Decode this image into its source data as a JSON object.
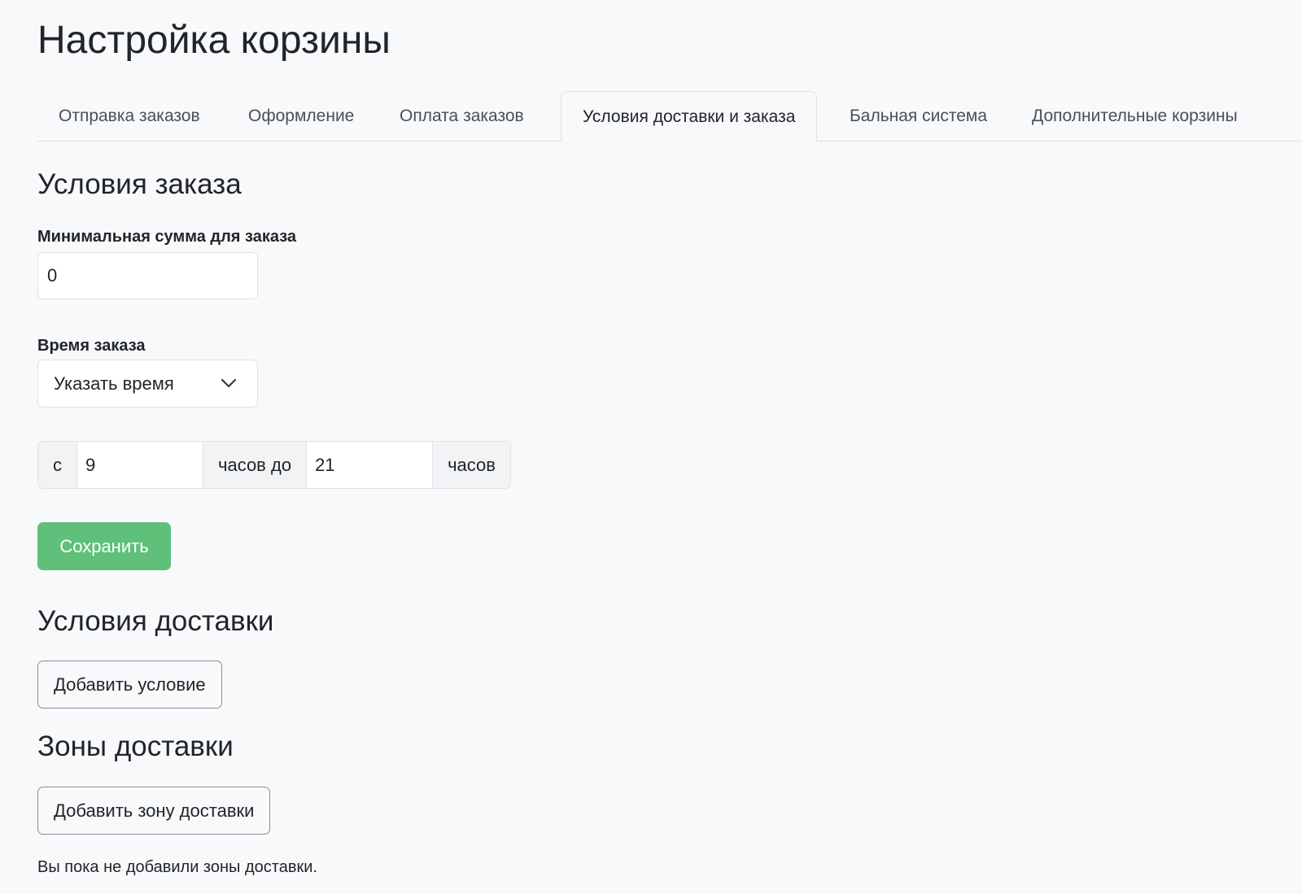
{
  "page": {
    "title": "Настройка корзины"
  },
  "tabs": [
    {
      "label": "Отправка заказов",
      "active": false
    },
    {
      "label": "Оформление",
      "active": false
    },
    {
      "label": "Оплата заказов",
      "active": false
    },
    {
      "label": "Условия доставки и заказа",
      "active": true
    },
    {
      "label": "Бальная система",
      "active": false
    },
    {
      "label": "Дополнительные корзины",
      "active": false
    }
  ],
  "order_conditions": {
    "title": "Условия заказа",
    "min_sum_label": "Минимальная сумма для заказа",
    "min_sum_value": "0",
    "time_label": "Время заказа",
    "time_selected": "Указать время",
    "from_prefix": "с",
    "from_value": "9",
    "middle_text": "часов до",
    "to_value": "21",
    "suffix_text": "часов",
    "save_label": "Сохранить"
  },
  "delivery_conditions": {
    "title": "Условия доставки",
    "add_label": "Добавить условие"
  },
  "delivery_zones": {
    "title": "Зоны доставки",
    "add_label": "Добавить зону доставки",
    "empty_text": "Вы пока не добавили зоны доставки."
  },
  "colors": {
    "accent_green": "#5fc07a",
    "background": "#f8f9fb",
    "border": "#dee2e6"
  }
}
